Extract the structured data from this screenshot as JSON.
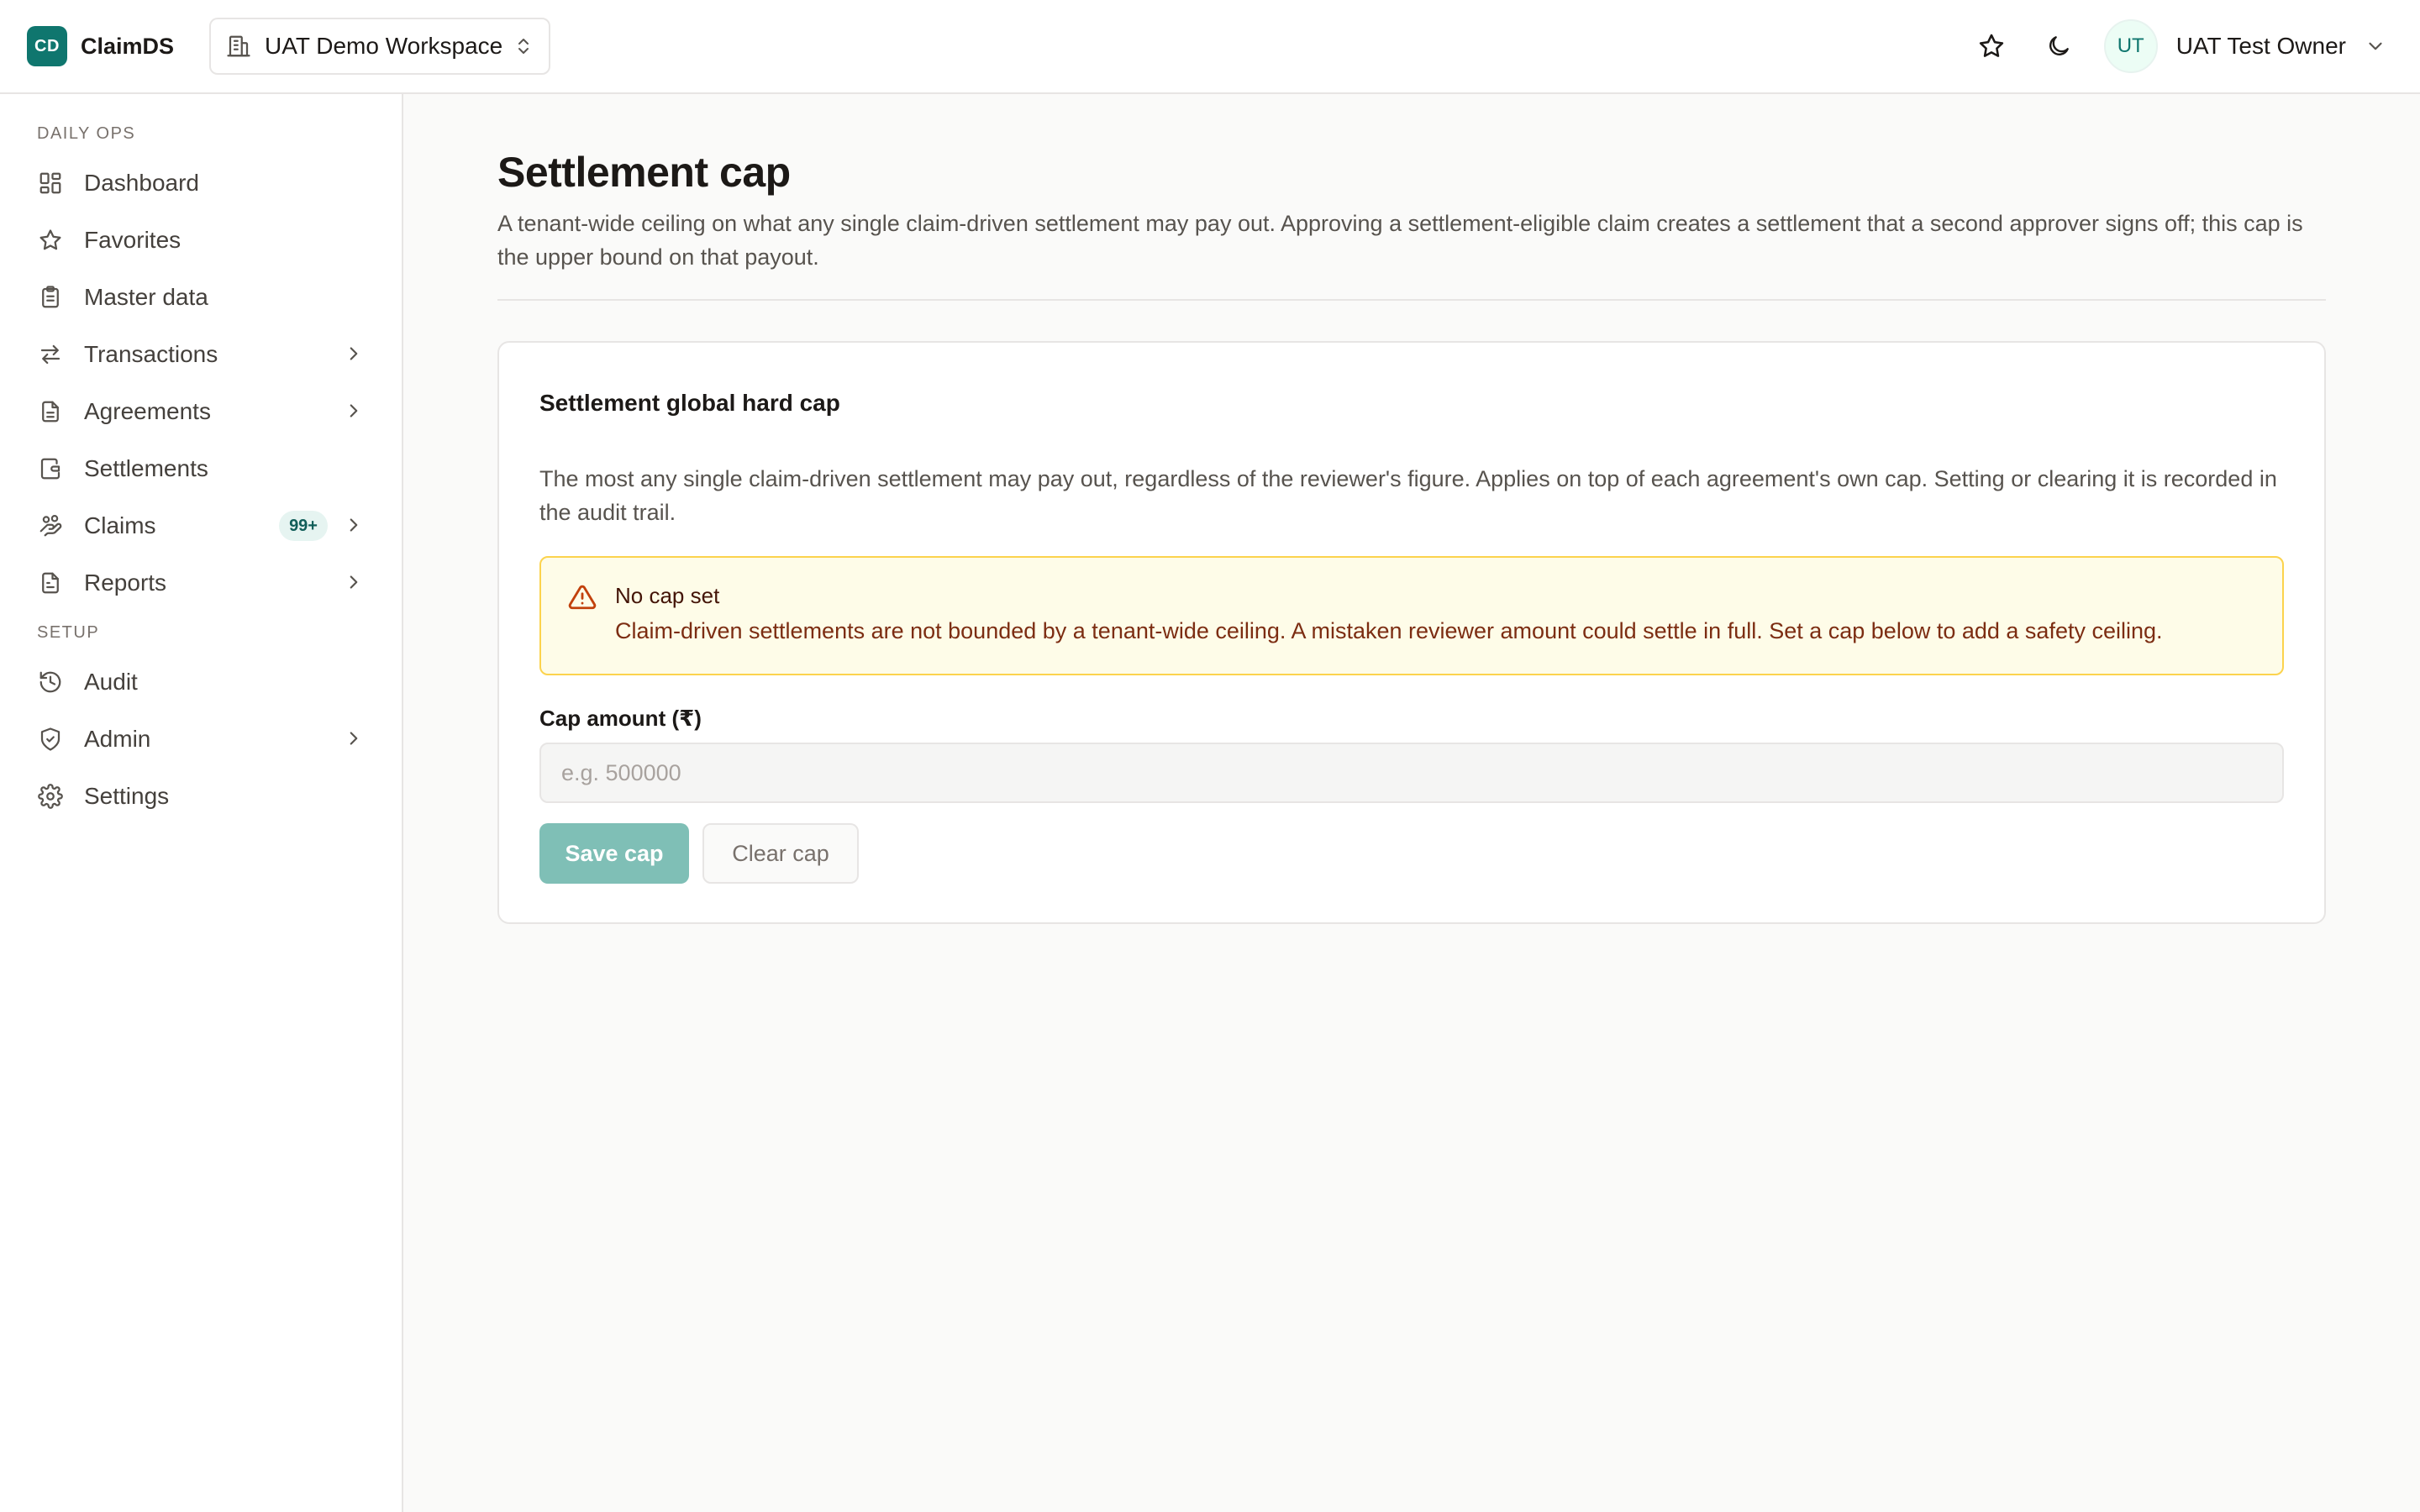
{
  "app": {
    "logo_text": "CD",
    "name": "ClaimDS"
  },
  "workspace": {
    "label": "UAT Demo Workspace"
  },
  "user": {
    "initials": "UT",
    "name": "UAT Test Owner"
  },
  "sidebar": {
    "sections": [
      {
        "label": "DAILY OPS",
        "items": [
          {
            "label": "Dashboard",
            "icon": "dashboard-icon"
          },
          {
            "label": "Favorites",
            "icon": "star-icon"
          },
          {
            "label": "Master data",
            "icon": "clipboard-icon"
          },
          {
            "label": "Transactions",
            "icon": "arrows-icon",
            "has_children": true
          },
          {
            "label": "Agreements",
            "icon": "document-icon",
            "has_children": true
          },
          {
            "label": "Settlements",
            "icon": "wallet-icon"
          },
          {
            "label": "Claims",
            "icon": "hand-coins-icon",
            "has_children": true,
            "badge": "99+"
          },
          {
            "label": "Reports",
            "icon": "report-icon",
            "has_children": true
          }
        ]
      },
      {
        "label": "SETUP",
        "items": [
          {
            "label": "Audit",
            "icon": "history-icon"
          },
          {
            "label": "Admin",
            "icon": "shield-icon",
            "has_children": true
          },
          {
            "label": "Settings",
            "icon": "gear-icon"
          }
        ]
      }
    ]
  },
  "page": {
    "title": "Settlement cap",
    "description": "A tenant-wide ceiling on what any single claim-driven settlement may pay out. Approving a settlement-eligible claim creates a settlement that a second approver signs off; this cap is the upper bound on that payout."
  },
  "card": {
    "title": "Settlement global hard cap",
    "description": "The most any single claim-driven settlement may pay out, regardless of the reviewer's figure. Applies on top of each agreement's own cap. Setting or clearing it is recorded in the audit trail.",
    "alert": {
      "title": "No cap set",
      "body": "Claim-driven settlements are not bounded by a tenant-wide ceiling. A mistaken reviewer amount could settle in full. Set a cap below to add a safety ceiling."
    },
    "field": {
      "label": "Cap amount (₹)",
      "placeholder": "e.g. 500000",
      "value": ""
    },
    "buttons": {
      "save": "Save cap",
      "clear": "Clear cap"
    }
  },
  "colors": {
    "brand": "#0f766e",
    "alert_bg": "#fefce8",
    "alert_border": "#fcd34d",
    "save_button_disabled": "#7fbfb6"
  }
}
